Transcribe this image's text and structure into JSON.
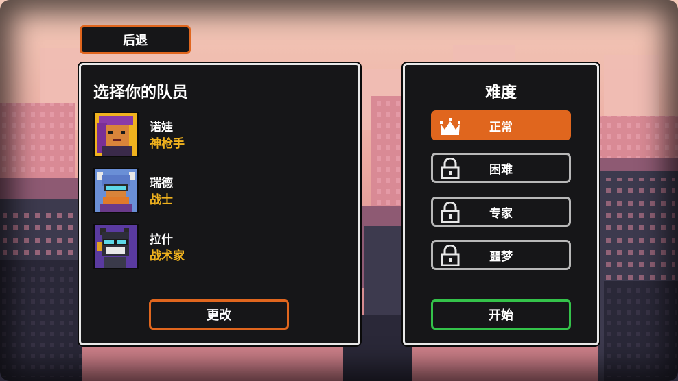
{
  "colors": {
    "accent_orange": "#e0661e",
    "role_gold": "#f0b21e",
    "start_green": "#34c24a",
    "panel_bg": "#161618",
    "border_light": "#e8e8e8"
  },
  "back_button": {
    "label": "后退",
    "icon": "none"
  },
  "team_panel": {
    "title": "选择你的队员",
    "members": [
      {
        "name": "诺娃",
        "role": "神枪手",
        "portrait": "nova-portrait"
      },
      {
        "name": "瑞德",
        "role": "战士",
        "portrait": "red-portrait"
      },
      {
        "name": "拉什",
        "role": "战术家",
        "portrait": "rush-portrait"
      }
    ],
    "change_label": "更改"
  },
  "difficulty_panel": {
    "title": "难度",
    "options": [
      {
        "label": "正常",
        "icon": "crown-icon",
        "selected": true,
        "locked": false
      },
      {
        "label": "困难",
        "icon": "lock-icon",
        "selected": false,
        "locked": true
      },
      {
        "label": "专家",
        "icon": "lock-icon",
        "selected": false,
        "locked": true
      },
      {
        "label": "噩梦",
        "icon": "lock-icon",
        "selected": false,
        "locked": true
      }
    ],
    "start_label": "开始"
  }
}
